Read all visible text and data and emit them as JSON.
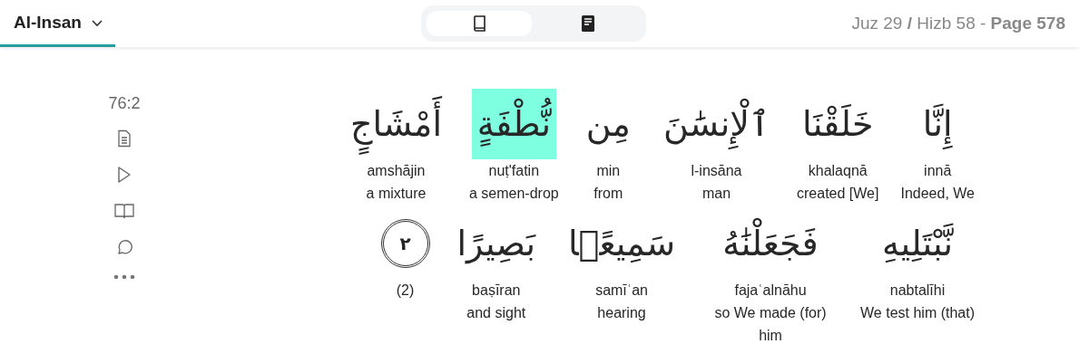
{
  "header": {
    "surah": "Al-Insan",
    "view_modes": [
      {
        "kind": "book",
        "selected": true
      },
      {
        "kind": "page",
        "selected": false
      }
    ],
    "location": "Juz 29 **/** Hizb 58 - **Page 578**"
  },
  "sidebar": {
    "verse_key": "76:2",
    "actions": [
      {
        "kind": "document"
      },
      {
        "kind": "play"
      },
      {
        "kind": "book"
      },
      {
        "kind": "comment"
      },
      {
        "kind": "more"
      }
    ]
  },
  "lines": [
    {
      "arabic_words": [
        {
          "kind": "word",
          "arabic": "إِنَّا",
          "highlighted": false
        },
        {
          "kind": "word",
          "arabic": "خَلَقْنَا",
          "highlighted": false
        },
        {
          "kind": "word",
          "arabic": "ٱلْإِنسَٰنَ",
          "highlighted": false
        },
        {
          "kind": "word",
          "arabic": "مِن",
          "highlighted": false
        },
        {
          "kind": "word",
          "arabic": "نُّطْفَةٍ",
          "highlighted": true
        },
        {
          "kind": "word",
          "arabic": "أَمْشَاجٍ",
          "highlighted": false
        }
      ],
      "glosses": [
        {
          "transliteration": "amshājin",
          "translation": "a mixture"
        },
        {
          "transliteration": "nuṭ'fatin",
          "translation": "a semen-drop"
        },
        {
          "transliteration": "min",
          "translation": "from"
        },
        {
          "transliteration": "l-insāna",
          "translation": "man"
        },
        {
          "transliteration": "khalaqnā",
          "translation": "created [We]"
        },
        {
          "transliteration": "innā",
          "translation": "Indeed, We"
        }
      ]
    },
    {
      "arabic_words": [
        {
          "kind": "word",
          "arabic": "نَّبْتَلِيهِ",
          "highlighted": false
        },
        {
          "kind": "word",
          "arabic": "فَجَعَلْنَٰهُ",
          "highlighted": false
        },
        {
          "kind": "word",
          "arabic": "سَمِيعًۢا",
          "highlighted": false
        },
        {
          "kind": "word",
          "arabic": "بَصِيرًا",
          "highlighted": false
        },
        {
          "kind": "end",
          "arabic": "٢"
        }
      ],
      "glosses": [
        {
          "transliteration": "(2)"
        },
        {
          "transliteration": "baṣīran",
          "translation": "and sight"
        },
        {
          "transliteration": "samīʿan",
          "translation": "hearing"
        },
        {
          "transliteration": "fajaʿalnāhu",
          "translation": "so We made (for) him"
        },
        {
          "transliteration": "nabtalīhi",
          "translation": "We test him (that)"
        }
      ]
    }
  ]
}
